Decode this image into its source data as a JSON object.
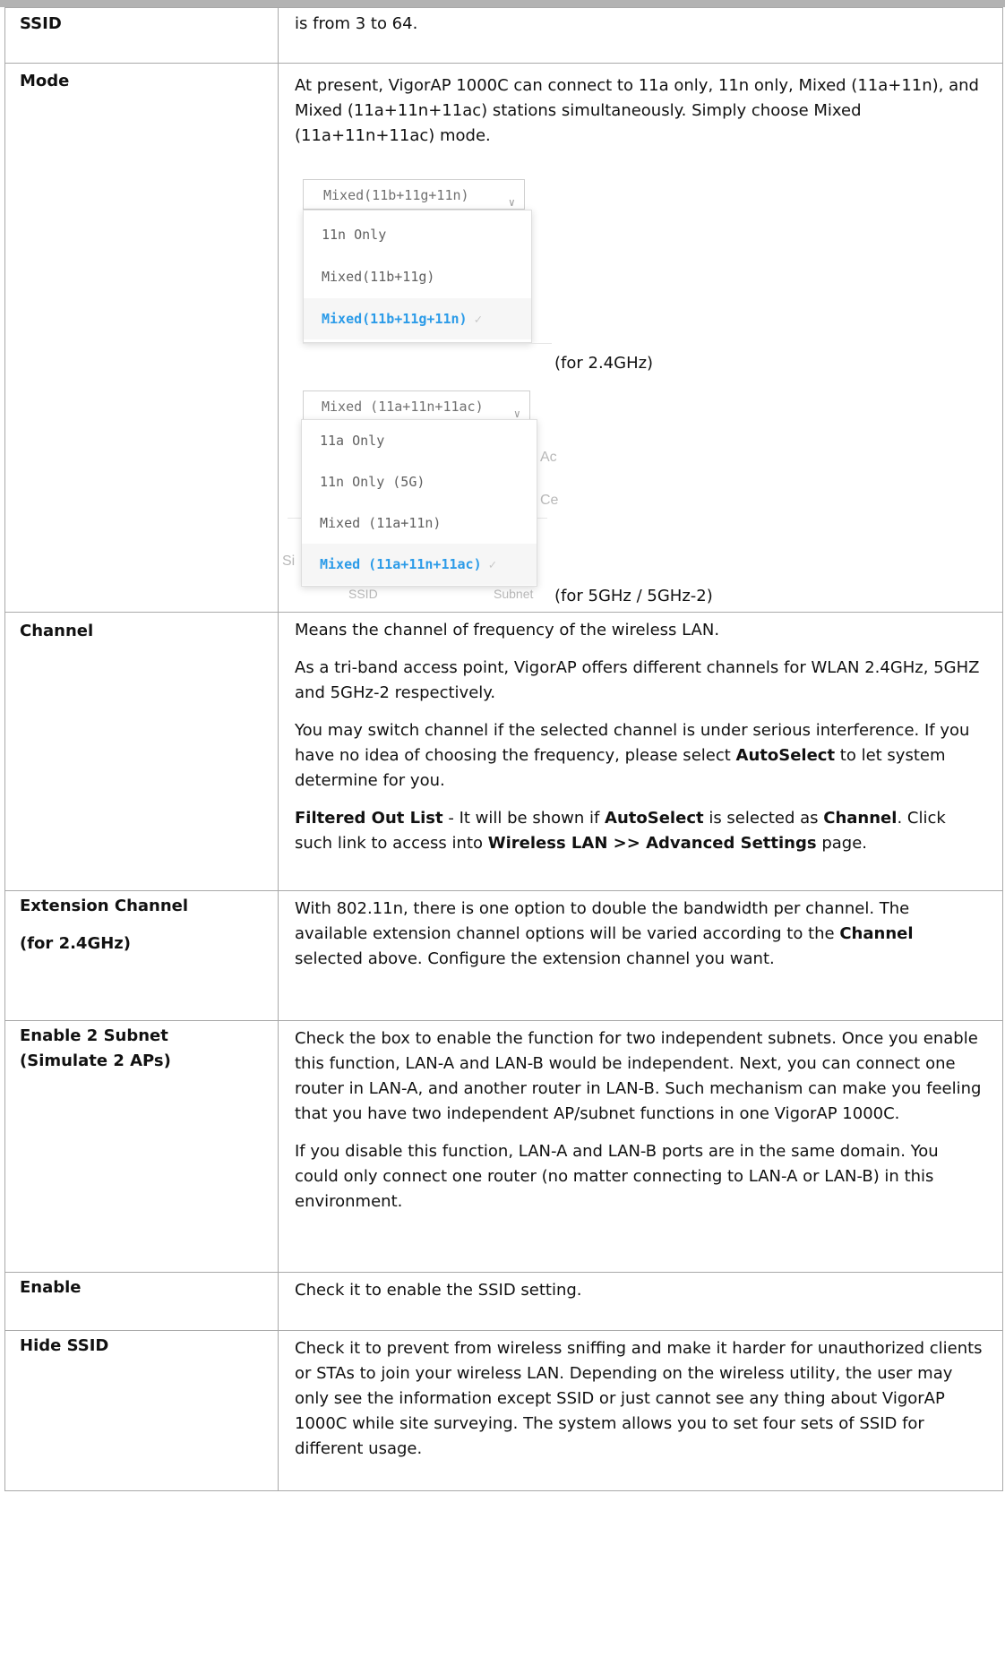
{
  "rows": {
    "ssid": {
      "term": "SSID",
      "desc": "is from 3 to 64."
    },
    "mode": {
      "term": "Mode",
      "desc": "At present, VigorAP 1000C can connect to 11a only, 11n only, Mixed (11a+11n), and Mixed (11a+11n+11ac) stations simultaneously. Simply choose Mixed (11a+11n+11ac) mode.",
      "fig24": {
        "selected": "Mixed(11b+11g+11n)",
        "options": [
          "11n Only",
          "Mixed(11b+11g)",
          "Mixed(11b+11g+11n)"
        ],
        "caption": "(for 2.4GHz)"
      },
      "fig5": {
        "selected": "Mixed (11a+11n+11ac)",
        "options": [
          "11a Only",
          "11n Only (5G)",
          "Mixed (11a+11n)",
          "Mixed (11a+11n+11ac)"
        ],
        "ghost": [
          "Ac",
          "Ce",
          "Si",
          "SSID",
          "Subnet"
        ],
        "caption": "(for 5GHz / 5GHz-2)"
      },
      "check": "✓"
    },
    "channel": {
      "term": "Channel",
      "p1": "Means the channel of frequency of the wireless LAN.",
      "p2": "As a tri-band access point, VigorAP offers different channels for WLAN 2.4GHz, 5GHZ and 5GHz-2 respectively.",
      "p3a": "You may switch channel if the selected channel is under serious interference. If you have no idea of choosing the frequency, please select ",
      "p3b": "AutoSelect",
      "p3c": " to let system determine for you.",
      "p4a": "Filtered Out List",
      "p4b": " - It will be shown if ",
      "p4c": "AutoSelect",
      "p4d": " is selected as ",
      "p4e": "Channel",
      "p4f": ". Click such link to access into ",
      "p4g": "Wireless LAN >> Advanced Settings",
      "p4h": " page."
    },
    "extension": {
      "term1": "Extension Channel",
      "term2": "(for 2.4GHz)",
      "d1": "With 802.11n, there is one option to double the bandwidth per channel. The available extension channel options will be varied according to the ",
      "d2": "Channel",
      "d3": " selected above. Configure the extension channel you want."
    },
    "subnet": {
      "term": "Enable 2 Subnet (Simulate 2 APs)",
      "p1": "Check the box to enable the function for two independent subnets. Once you enable this function, LAN-A and LAN-B would be independent. Next, you can connect one router in LAN-A, and another router in LAN-B. Such mechanism can make you feeling that you have two independent AP/subnet functions in one VigorAP 1000C.",
      "p2": "If you disable this function, LAN-A and LAN-B ports are in the same domain. You could only connect one router (no matter connecting to LAN-A or LAN-B) in this environment."
    },
    "enable": {
      "term": "Enable",
      "desc": "Check it to enable the SSID setting."
    },
    "hide": {
      "term": "Hide SSID",
      "desc": "Check it to prevent from wireless sniffing and make it harder for unauthorized clients or STAs to join your wireless LAN. Depending on the wireless utility, the user may only see the information except SSID or just cannot see any thing about VigorAP 1000C while site surveying. The system allows you to set four sets of SSID for different usage."
    }
  }
}
